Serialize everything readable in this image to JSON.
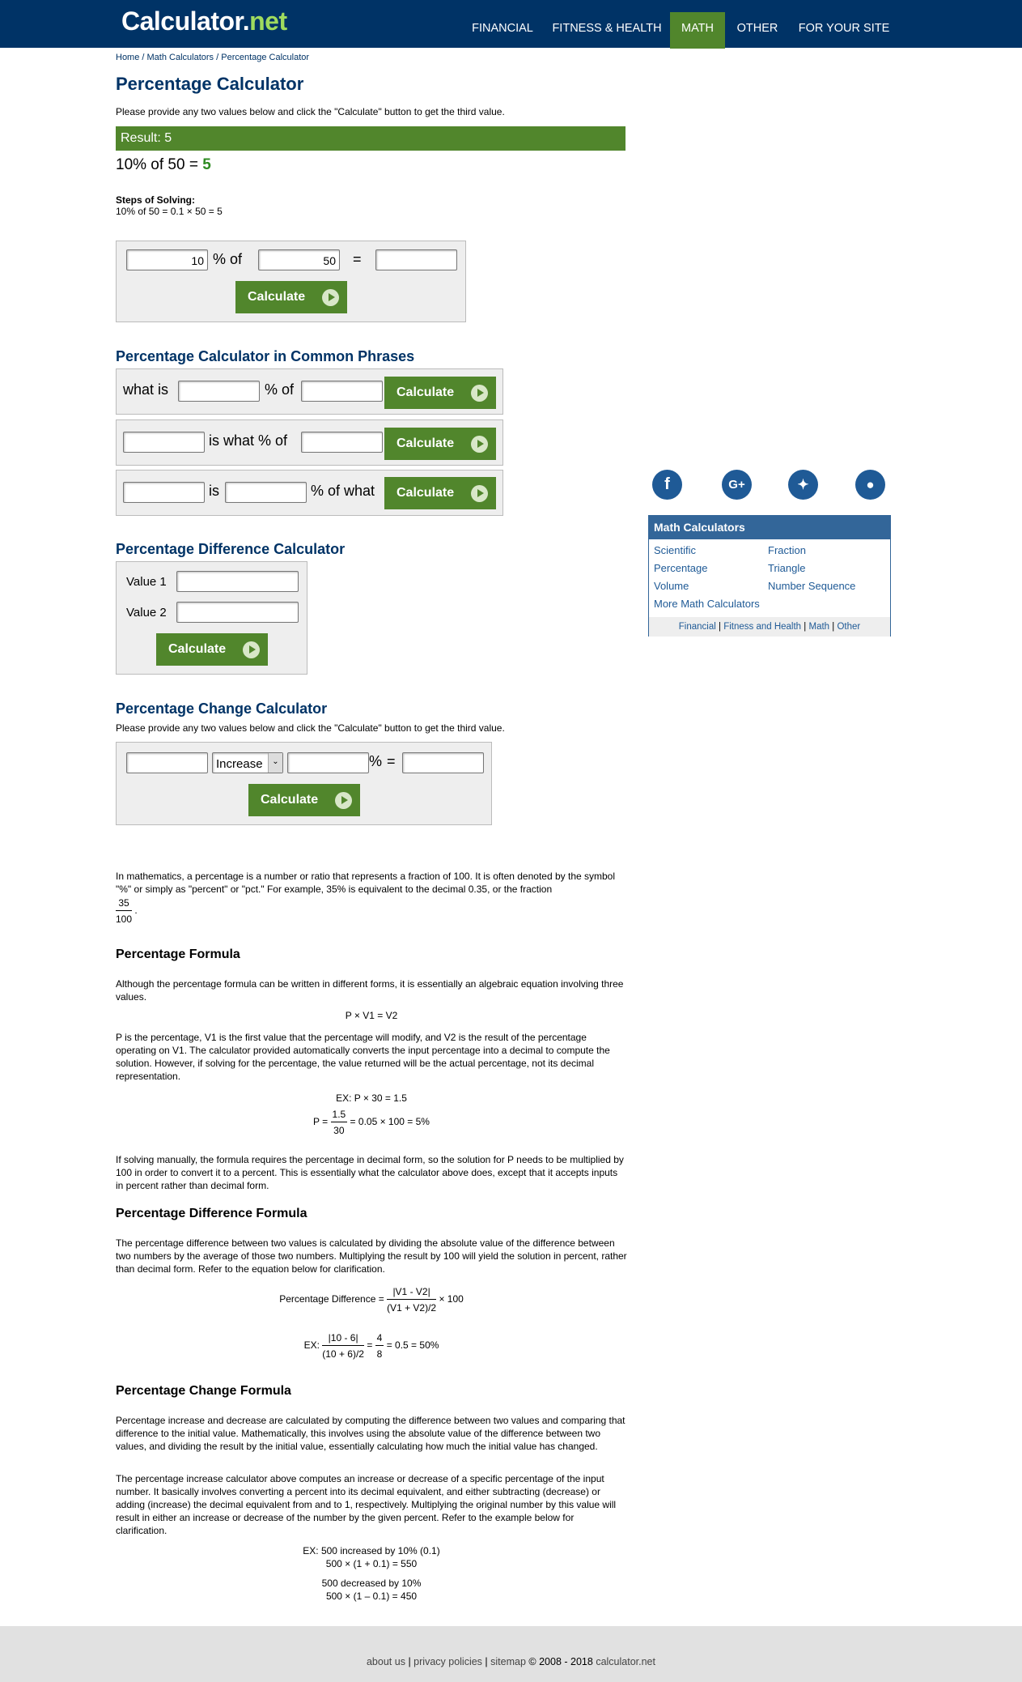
{
  "header": {
    "logo_main": "Calculator",
    "logo_dot": ".",
    "logo_net": "net",
    "nav": [
      "FINANCIAL",
      "FITNESS & HEALTH",
      "MATH",
      "OTHER",
      "FOR YOUR SITE"
    ],
    "active_nav": "MATH"
  },
  "breadcrumb": [
    "Home",
    "Math Calculators",
    "Percentage Calculator"
  ],
  "page_title": "Percentage Calculator",
  "intro": "Please provide any two values below and click the \"Calculate\" button to get the third value.",
  "result": {
    "bar": "Result: 5",
    "equation_prefix": "10% of 50 = ",
    "equation_value": "5",
    "steps_title": "Steps of Solving:",
    "steps_line": "10% of 50 = 0.1 × 50 = 5"
  },
  "main_calc": {
    "pct_value": "10",
    "pct_of_label": "% of",
    "of_value": "50",
    "equals_label": "=",
    "result_value": "",
    "button": "Calculate"
  },
  "common_phrases": {
    "title": "Percentage Calculator in Common Phrases",
    "row1": {
      "prefix": "what is",
      "mid": "% of",
      "button": "Calculate"
    },
    "row2": {
      "mid": "is what % of",
      "button": "Calculate"
    },
    "row3": {
      "mid1": "is",
      "mid2": "% of what",
      "button": "Calculate"
    }
  },
  "difference": {
    "title": "Percentage Difference Calculator",
    "value1_label": "Value 1",
    "value2_label": "Value 2",
    "button": "Calculate"
  },
  "change": {
    "title": "Percentage Change Calculator",
    "intro": "Please provide any two values below and click the \"Calculate\" button to get the third value.",
    "select_value": "Increase",
    "pct_label": "%",
    "equals_label": "=",
    "button": "Calculate"
  },
  "article": {
    "intro1": "In mathematics, a percentage is a number or ratio that represents a fraction of 100. It is often denoted by the symbol \"%\" or simply as \"percent\" or \"pct.\" For example, 35% is equivalent to the decimal 0.35, or the fraction",
    "intro_frac_num": "35",
    "intro_frac_den": "100",
    "formula_title": "Percentage Formula",
    "formula_p1": "Although the percentage formula can be written in different forms, it is essentially an algebraic equation involving three values.",
    "formula_eq": "P × V1 = V2",
    "formula_p2": "P is the percentage, V1 is the first value that the percentage will modify, and V2 is the result of the percentage operating on V1. The calculator provided automatically converts the input percentage into a decimal to compute the solution. However, if solving for the percentage, the value returned will be the actual percentage, not its decimal representation.",
    "ex1": "EX: P × 30 = 1.5",
    "ex1_lhs": "P =",
    "ex1_num": "1.5",
    "ex1_den": "30",
    "ex1_rhs": "= 0.05 × 100 = 5%",
    "formula_p3": "If solving manually, the formula requires the percentage in decimal form, so the solution for P needs to be multiplied by 100 in order to convert it to a percent. This is essentially what the calculator above does, except that it accepts inputs in percent rather than decimal form.",
    "diff_title": "Percentage Difference Formula",
    "diff_p1": "The percentage difference between two values is calculated by dividing the absolute value of the difference between two numbers by the average of those two numbers. Multiplying the result by 100 will yield the solution in percent, rather than decimal form. Refer to the equation below for clarification.",
    "diff_eq_lhs": "Percentage Difference =",
    "diff_eq_num": "|V1 - V2|",
    "diff_eq_den": "(V1 + V2)/2",
    "diff_eq_rhs": "× 100",
    "diff_ex_lhs": "EX:",
    "diff_ex_num": "|10 - 6|",
    "diff_ex_den": "(10 + 6)/2",
    "diff_ex_eq": "=",
    "diff_ex_num2": "4",
    "diff_ex_den2": "8",
    "diff_ex_rhs": "= 0.5 = 50%",
    "change_title": "Percentage Change Formula",
    "change_p1": "Percentage increase and decrease are calculated by computing the difference between two values and comparing that difference to the initial value. Mathematically, this involves using the absolute value of the difference between two values, and dividing the result by the initial value, essentially calculating how much the initial value has changed.",
    "change_p2": "The percentage increase calculator above computes an increase or decrease of a specific percentage of the input number. It basically involves converting a percent into its decimal equivalent, and either subtracting (decrease) or adding (increase) the decimal equivalent from and to 1, respectively. Multiplying the original number by this value will result in either an increase or decrease of the number by the given percent. Refer to the example below for clarification.",
    "change_ex1": "EX: 500 increased by 10% (0.1)",
    "change_ex2": "500 × (1 + 0.1) = 550",
    "change_ex3": "500 decreased by 10%",
    "change_ex4": "500 × (1 – 0.1) = 450"
  },
  "sidebar": {
    "social": [
      "facebook-icon",
      "google-plus-icon",
      "twitter-icon",
      "reddit-icon"
    ],
    "box_title": "Math Calculators",
    "links": [
      "Scientific",
      "Fraction",
      "Percentage",
      "Triangle",
      "Volume",
      "Number Sequence",
      "More Math Calculators"
    ],
    "footer_links": [
      "Financial",
      "Fitness and Health",
      "Math",
      "Other"
    ],
    "footer_sep": "|"
  },
  "footer": {
    "about": "about us",
    "privacy": "privacy policies",
    "sitemap": "sitemap",
    "copyright": "© 2008 - 2018",
    "site": "calculator.net",
    "sep": "|"
  },
  "colors": {
    "brand_blue": "#003366",
    "accent_green": "#51862c",
    "result_green": "#2e8b22"
  }
}
